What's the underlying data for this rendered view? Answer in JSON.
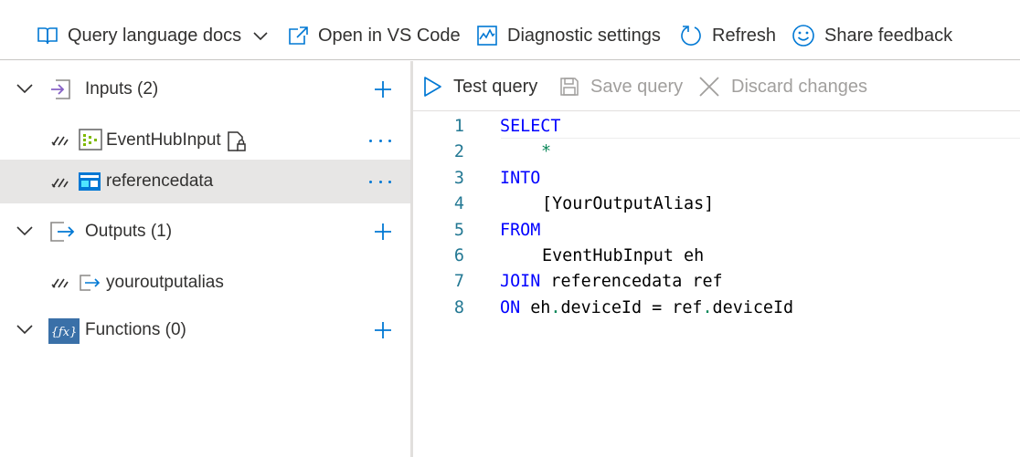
{
  "toolbar": {
    "docs": "Query language docs",
    "vscode": "Open in VS Code",
    "diagnostics": "Diagnostic settings",
    "refresh": "Refresh",
    "feedback": "Share feedback"
  },
  "tree": {
    "inputs": {
      "label": "Inputs (2)",
      "items": [
        "EventHubInput",
        "referencedata"
      ]
    },
    "outputs": {
      "label": "Outputs (1)",
      "items": [
        "youroutputalias"
      ]
    },
    "functions": {
      "label": "Functions (0)"
    }
  },
  "editor_toolbar": {
    "test": "Test query",
    "save": "Save query",
    "discard": "Discard changes"
  },
  "code": {
    "line_numbers": [
      "1",
      "2",
      "3",
      "4",
      "5",
      "6",
      "7",
      "8"
    ],
    "l1_kw": "SELECT",
    "l2_star": "*",
    "l3_kw": "INTO",
    "l4_text": "[YourOutputAlias]",
    "l5_kw": "FROM",
    "l6_text": "EventHubInput eh",
    "l7_kw": "JOIN",
    "l7_text": " referencedata ref",
    "l8_kw": "ON",
    "l8_a": " eh",
    "l8_dot1": ".",
    "l8_b": "deviceId = ref",
    "l8_dot2": ".",
    "l8_c": "deviceId"
  },
  "colors": {
    "accent": "#0078d4",
    "keyword": "#0000ff",
    "line_number": "#237893",
    "operator": "#098658",
    "selected_row": "#e7e6e5",
    "disabled_text": "#a19f9d"
  }
}
